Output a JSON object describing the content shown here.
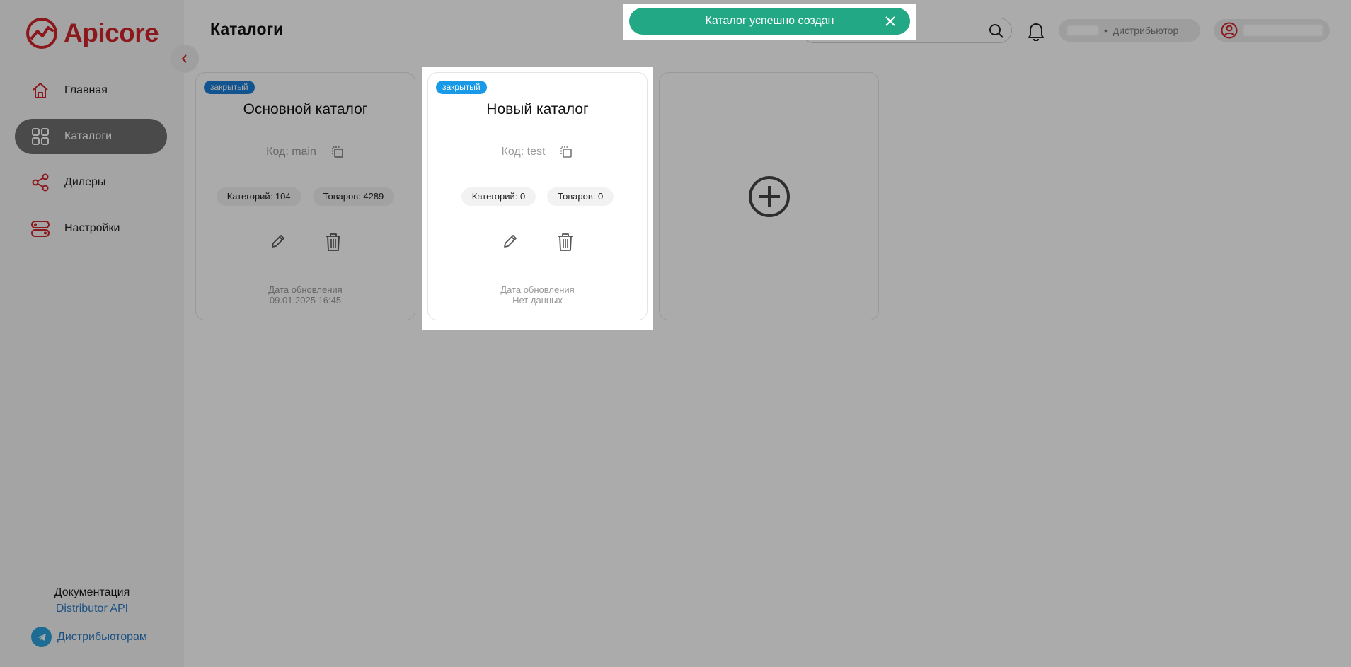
{
  "app": {
    "brand": "Apicore",
    "brand_color": "#d0242a"
  },
  "sidebar": {
    "items": [
      {
        "label": "Главная",
        "icon": "home-icon"
      },
      {
        "label": "Каталоги",
        "icon": "grid-icon",
        "active": true
      },
      {
        "label": "Дилеры",
        "icon": "share-icon"
      },
      {
        "label": "Настройки",
        "icon": "toggles-icon"
      }
    ],
    "docs_label": "Документация",
    "docs_link": "Distributor API",
    "telegram_label": "Дистрибьюторам"
  },
  "header": {
    "title": "Каталоги",
    "role": "дистрибьютор"
  },
  "catalogs": [
    {
      "badge": "закрытый",
      "name": "Основной каталог",
      "code": "Код: main",
      "categories": "Категорий: 104",
      "products": "Товаров: 4289",
      "updated_label": "Дата обновления",
      "updated_value": "09.01.2025 16:45"
    },
    {
      "badge": "закрытый",
      "name": "Новый каталог",
      "code": "Код: test",
      "categories": "Категорий: 0",
      "products": "Товаров: 0",
      "updated_label": "Дата обновления",
      "updated_value": "Нет данных"
    }
  ],
  "toast": {
    "message": "Каталог успешно создан",
    "color": "#22a884"
  },
  "colors": {
    "badge": "#1c7ed6",
    "link": "#2b79c5",
    "active_nav": "#6f6f6f"
  }
}
